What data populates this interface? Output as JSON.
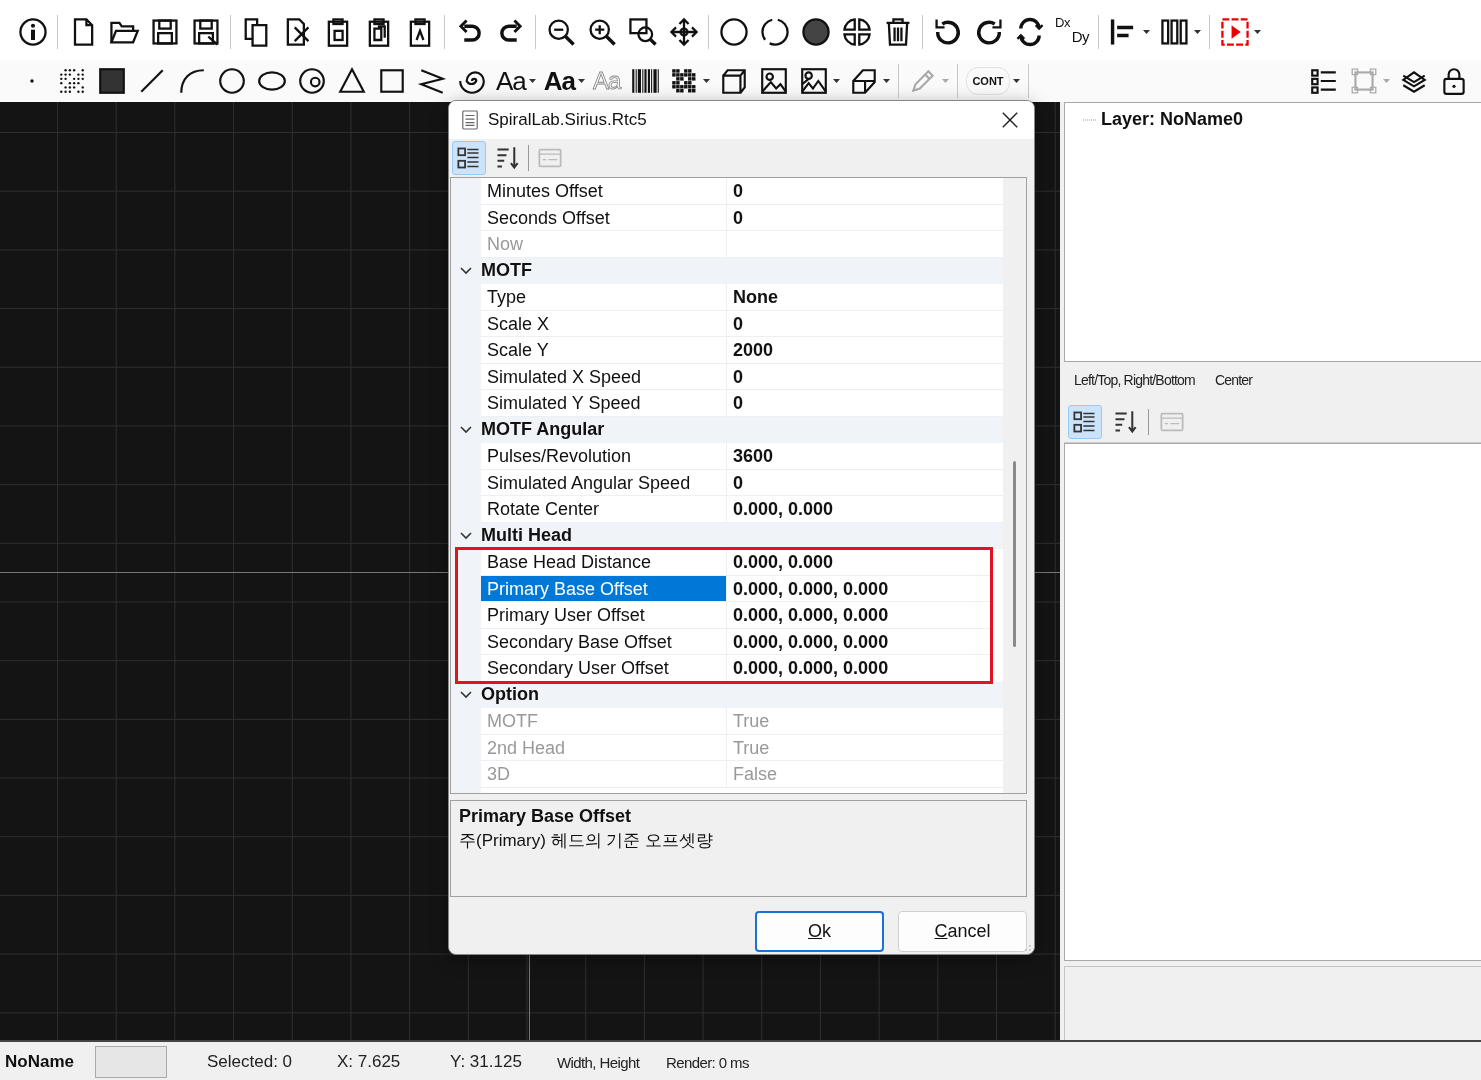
{
  "toolbar": {
    "delta": {
      "top": "Dx",
      "bottom": "Dy"
    },
    "text_tools": [
      {
        "kind": "font",
        "label": "Aa"
      },
      {
        "kind": "bold-font",
        "label": "Aa"
      },
      {
        "kind": "outline-font",
        "label": "Aa"
      },
      {
        "kind": "mode",
        "label": "CONT"
      }
    ]
  },
  "dialog": {
    "title": "SpiralLab.Sirius.Rtc5",
    "view_buttons": [
      {
        "kind": "categorized",
        "selected": true,
        "disabled": false
      },
      {
        "kind": "alphabetical",
        "selected": false,
        "disabled": false
      },
      {
        "kind": "property-pages",
        "selected": false,
        "disabled": true
      }
    ],
    "property_grid": {
      "items": [
        {
          "kind": "property",
          "name": "Minutes Offset",
          "value": "0",
          "disabled": false,
          "selected": false
        },
        {
          "kind": "property",
          "name": "Seconds Offset",
          "value": "0",
          "disabled": false,
          "selected": false
        },
        {
          "kind": "property",
          "name": "Now",
          "disabled": true,
          "selected": false
        },
        {
          "kind": "category",
          "name": "MOTF",
          "expanded": true,
          "outlined": false,
          "children": [
            {
              "name": "Type",
              "value": "None",
              "disabled": false,
              "selected": false
            },
            {
              "name": "Scale X",
              "value": "0",
              "disabled": false,
              "selected": false
            },
            {
              "name": "Scale Y",
              "value": "2000",
              "disabled": false,
              "selected": false
            },
            {
              "name": "Simulated X Speed",
              "value": "0",
              "disabled": false,
              "selected": false
            },
            {
              "name": "Simulated Y Speed",
              "value": "0",
              "disabled": false,
              "selected": false
            }
          ]
        },
        {
          "kind": "category",
          "name": "MOTF Angular",
          "expanded": true,
          "outlined": false,
          "children": [
            {
              "name": "Pulses/Revolution",
              "value": "3600",
              "disabled": false,
              "selected": false
            },
            {
              "name": "Simulated Angular Speed",
              "value": "0",
              "disabled": false,
              "selected": false
            },
            {
              "name": "Rotate Center",
              "value": "0.000, 0.000",
              "disabled": false,
              "selected": false
            }
          ]
        },
        {
          "kind": "category",
          "name": "Multi Head",
          "expanded": true,
          "outlined": true,
          "children": [
            {
              "name": "Base Head Distance",
              "value": "0.000, 0.000",
              "disabled": false,
              "selected": false
            },
            {
              "name": "Primary Base Offset",
              "value": "0.000, 0.000, 0.000",
              "disabled": false,
              "selected": true
            },
            {
              "name": "Primary User Offset",
              "value": "0.000, 0.000, 0.000",
              "disabled": false,
              "selected": false
            },
            {
              "name": "Secondary Base Offset",
              "value": "0.000, 0.000, 0.000",
              "disabled": false,
              "selected": false
            },
            {
              "name": "Secondary User Offset",
              "value": "0.000, 0.000, 0.000",
              "disabled": false,
              "selected": false
            }
          ]
        },
        {
          "kind": "category",
          "name": "Option",
          "expanded": true,
          "outlined": false,
          "children": [
            {
              "name": "MOTF",
              "value": "True",
              "disabled": true,
              "selected": false
            },
            {
              "name": "2nd Head",
              "value": "True",
              "disabled": true,
              "selected": false
            },
            {
              "name": "3D",
              "value": "False",
              "disabled": true,
              "selected": false
            }
          ]
        }
      ]
    },
    "description": {
      "title": "Primary Base Offset",
      "text": "주(Primary) 헤드의 기준 오프셋량"
    },
    "buttons": [
      {
        "label": "Ok",
        "focused": true
      },
      {
        "label": "Cancel",
        "focused": false
      }
    ]
  },
  "right_panel": {
    "tree": [
      {
        "label": "Layer: NoName0"
      }
    ],
    "labels": [
      "Left/Top, Right/Bottom",
      "Center"
    ],
    "view_buttons": [
      {
        "kind": "categorized",
        "selected": true,
        "disabled": false
      },
      {
        "kind": "alphabetical",
        "selected": false,
        "disabled": false
      },
      {
        "kind": "property-pages",
        "selected": false,
        "disabled": true
      }
    ]
  },
  "status_bar": {
    "document": "NoName",
    "items": [
      "Selected: 0",
      "X: 7.625",
      "Y: 31.125",
      "Width, Height",
      "Render: 0 ms"
    ]
  }
}
